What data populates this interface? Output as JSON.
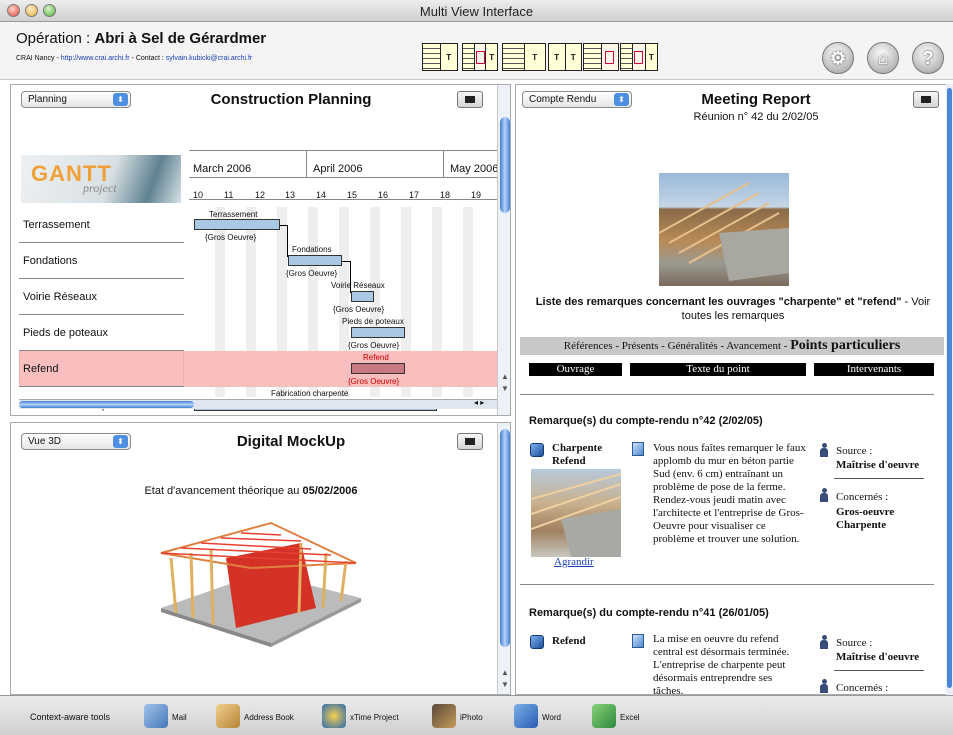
{
  "window": {
    "title": "Multi View Interface"
  },
  "header": {
    "operation_label": "Opération : ",
    "operation_name": "Abri à Sel de Gérardmer",
    "credit_prefix": "CRAI Nancy - ",
    "credit_url": "http://www.crai.archi.fr",
    "credit_mid": " - Contact : ",
    "credit_email": "sylvain.kubicki@crai.archi.fr",
    "text_block_letter": "T",
    "round_buttons": [
      "settings-icon",
      "home-icon",
      "help-icon"
    ],
    "help_glyph": "?"
  },
  "planning": {
    "selector": "Planning",
    "title": "Construction Planning",
    "logo_text": "GANTT",
    "logo_sub": "project",
    "months": [
      "March 2006",
      "April 2006",
      "May 2006"
    ],
    "days": [
      "10",
      "11",
      "12",
      "13",
      "14",
      "15",
      "16",
      "17",
      "18",
      "19"
    ],
    "tasks": [
      {
        "name": "Terrassement",
        "label": "Terrassement",
        "group": "{Gros Oeuvre}"
      },
      {
        "name": "Fondations",
        "label": "Fondations",
        "group": "{Gros Oeuvre}"
      },
      {
        "name": "Voirie Réseaux",
        "label": "Voirie Réseaux",
        "group": "{Gros Oeuvre}"
      },
      {
        "name": "Pieds de poteaux",
        "label": "Pieds de poteaux",
        "group": "{Gros Oeuvre}"
      },
      {
        "name": "Refend",
        "label": "Refend",
        "group": "{Gros Oeuvre}",
        "highlight": true
      },
      {
        "name": "Fabrication charpente",
        "label": "Fabrication charpente",
        "group": ""
      }
    ]
  },
  "mockup": {
    "selector": "Vue 3D",
    "title": "Digital MockUp",
    "status_text": "Etat d'avancement théorique au ",
    "status_date": "05/02/2006"
  },
  "report": {
    "selector": "Compte Rendu",
    "title": "Meeting Report",
    "subtitle": "Réunion n° 42 du 2/02/05",
    "remarks_heading": "Liste des remarques concernant les ouvrages \"charpente\" et \"refend\"",
    "remarks_link": " - Voir toutes les remarques",
    "nav_items": [
      "Références",
      "Présents",
      "Généralités",
      "Avancement"
    ],
    "nav_sep": " - ",
    "nav_current": "Points particuliers",
    "columns": [
      "Ouvrage",
      "Texte du point",
      "Intervenants"
    ],
    "entries": [
      {
        "heading": "Remarque(s) du compte-rendu n°42 (2/02/05)",
        "ouvrages": [
          "Charpente",
          "Refend"
        ],
        "enlarge": "Agrandir",
        "text": "Vous nous faîtes remarquer le faux applomb du mur en béton partie Sud (env. 6 cm) entraînant un problème de pose de la ferme. Rendez-vous jeudi matin avec l'architecte et l'entreprise de Gros-Oeuvre pour visualiser ce problème et trouver une solution.",
        "source_label": "Source :",
        "source": "Maîtrise d'oeuvre",
        "concerned_label": "Concernés :",
        "concerned": [
          "Gros-oeuvre",
          "Charpente"
        ]
      },
      {
        "heading": "Remarque(s) du compte-rendu n°41 (26/01/05)",
        "ouvrages": [
          "Refend"
        ],
        "text": "La mise en oeuvre du refend central est désormais terminée. L'entreprise de charpente peut désormais entreprendre ses tâches.",
        "source_label": "Source :",
        "source": "Maîtrise d'oeuvre",
        "concerned_label": "Concernés :"
      }
    ]
  },
  "dock": {
    "label": "Context-aware tools",
    "apps": [
      "Mail",
      "Address Book",
      "xTime Project",
      "iPhoto",
      "Word",
      "Excel"
    ]
  }
}
